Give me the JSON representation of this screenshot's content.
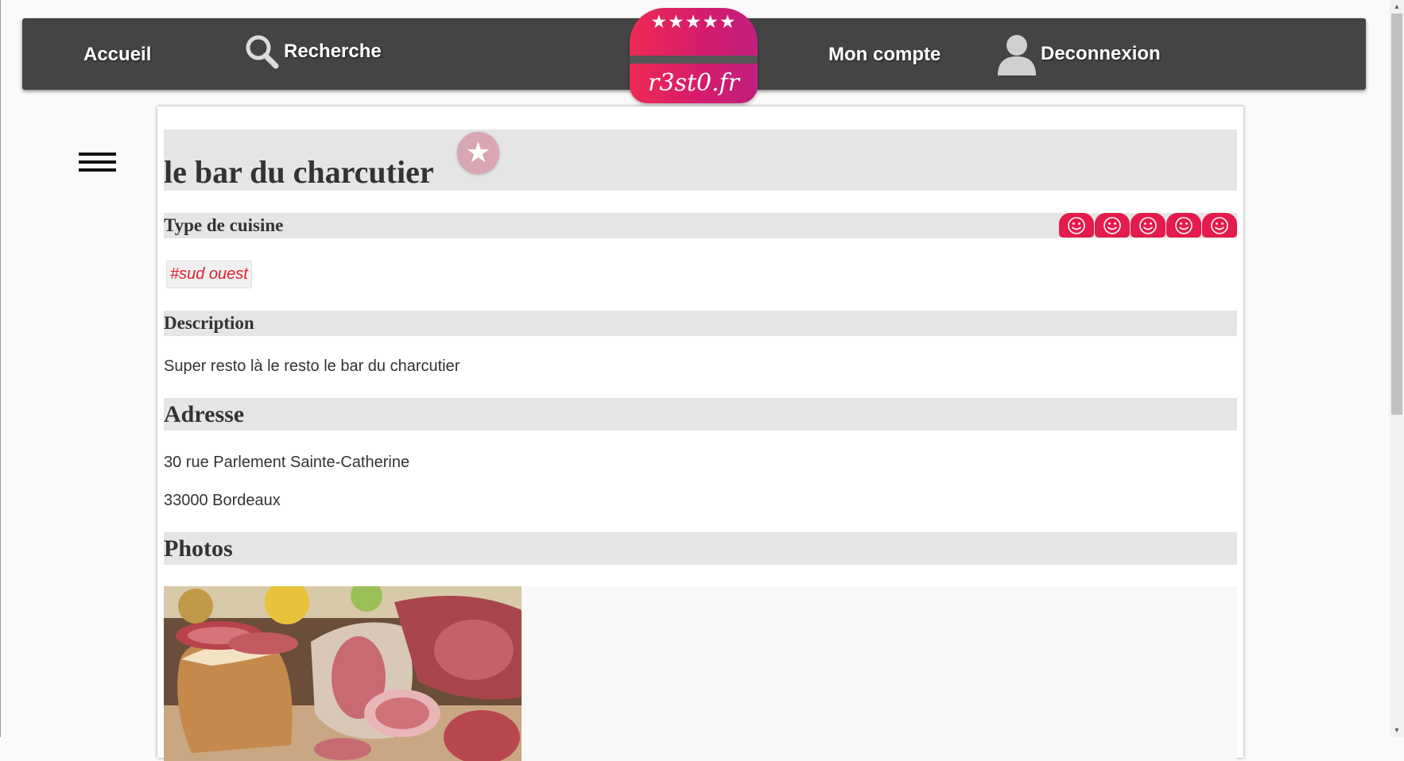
{
  "nav": {
    "home": "Accueil",
    "search": "Recherche",
    "account": "Mon compte",
    "logout": "Deconnexion"
  },
  "logo": {
    "stars": "★★★★★",
    "text": "r3st0.fr",
    "colors": [
      "#ee2a52",
      "#bf1f7e"
    ]
  },
  "restaurant": {
    "name": "le bar du charcutier",
    "favorite_icon": "star-icon",
    "cuisine_heading": "Type de cuisine",
    "rating": 5,
    "rating_max": 5,
    "rating_icon": "smiley-icon",
    "tag": "#sud ouest",
    "description_heading": "Description",
    "description": "Super resto là le resto le bar du charcutier",
    "address_heading": "Adresse",
    "address_line1": "30 rue Parlement Sainte-Catherine",
    "address_line2": "33000 Bordeaux",
    "photos_heading": "Photos"
  },
  "colors": {
    "navbar": "#444444",
    "accent": "#e41b4c",
    "tag_text": "#e0212f",
    "section_bar": "#e5e5e5"
  }
}
